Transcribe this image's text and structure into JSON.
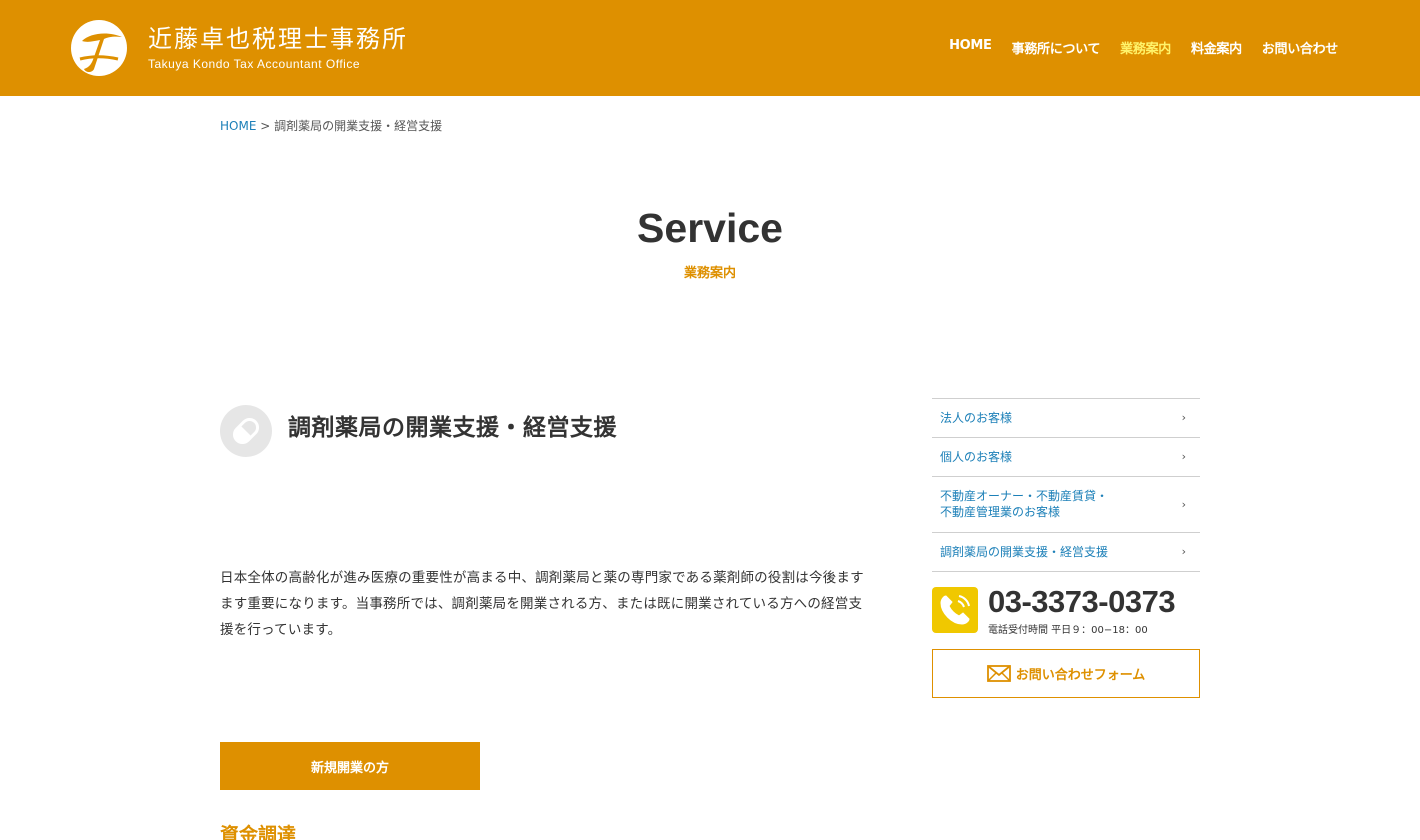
{
  "header": {
    "logo_icon": "stylized-t-logo-icon",
    "logo_jp": "近藤卓也税理士事務所",
    "logo_en": "Takuya Kondo Tax Accountant Office",
    "nav": [
      {
        "label": "HOME"
      },
      {
        "label": "事務所について"
      },
      {
        "label": "業務案内",
        "current": true
      },
      {
        "label": "料金案内"
      },
      {
        "label": "お問い合わせ"
      }
    ]
  },
  "breadcrumb": {
    "home": "HOME",
    "separator": " > ",
    "current": "調剤薬局の開業支援・経営支援"
  },
  "page": {
    "title": "Service",
    "subtitle": "業務案内"
  },
  "content": {
    "icon": "capsule-pill-icon",
    "heading": "調剤薬局の開業支援・経営支援",
    "lead": "日本全体の高齢化が進み医療の重要性が高まる中、調剤薬局と薬の専門家である薬剤師の役割は今後ますます重要になります。当事務所では、調剤薬局を開業される方、または既に開業されている方への経営支援を行っています。",
    "button": "新規開業の方",
    "section_heading": "資金調達"
  },
  "sidebar": {
    "items": [
      {
        "label": "法人のお客様"
      },
      {
        "label": "個人のお客様"
      },
      {
        "label": "不動産オーナー・不動産賃貸・\n不動産管理業のお客様"
      },
      {
        "label": "調剤薬局の開業支援・経営支援"
      }
    ],
    "arrow": "›",
    "tel_icon": "phone-handset-icon",
    "tel": "03-3373-0373",
    "tel_hours": "電話受付時間 平日９：00−18：00",
    "contact_icon": "mail-envelope-icon",
    "contact_label": "お問い合わせフォーム"
  },
  "colors": {
    "brand": "#de9000",
    "nav_current": "#fff36a",
    "link": "#1d80b8",
    "tel_icon_bg": "#f0c800"
  }
}
